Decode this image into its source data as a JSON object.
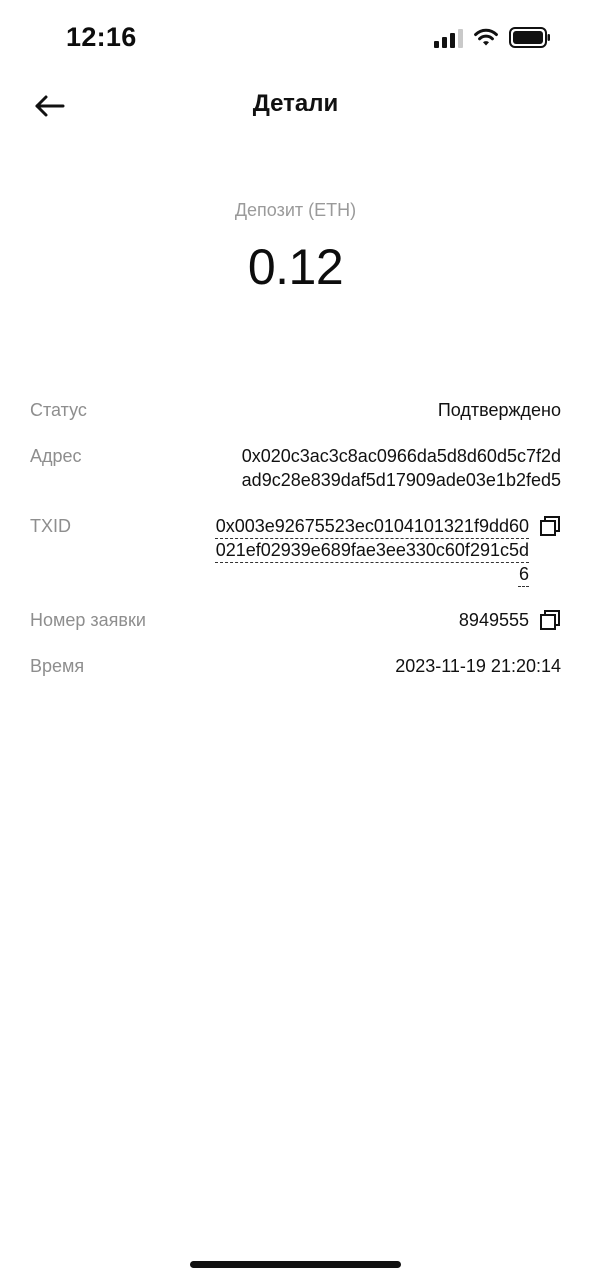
{
  "status_bar": {
    "time": "12:16"
  },
  "header": {
    "title": "Детали",
    "back_icon": "arrow-left-icon"
  },
  "summary": {
    "label": "Депозит (ETH)",
    "amount": "0.12"
  },
  "details": {
    "status": {
      "label": "Статус",
      "value": "Подтверждено"
    },
    "address": {
      "label": "Адрес",
      "value": "0x020c3ac3c8ac0966da5d8d60d5c7f2dad9c28e839daf5d17909ade03e1b2fed5"
    },
    "txid": {
      "label": "TXID",
      "value": "0x003e92675523ec0104101321f9dd60021ef02939e689fae3ee330c60f291c5d6",
      "icon": "copy-icon"
    },
    "order_number": {
      "label": "Номер заявки",
      "value": "8949555",
      "icon": "copy-icon"
    },
    "time": {
      "label": "Время",
      "value": "2023-11-19 21:20:14"
    }
  },
  "colors": {
    "text_primary": "#111111",
    "text_secondary": "#8e8e8e",
    "background": "#ffffff"
  }
}
